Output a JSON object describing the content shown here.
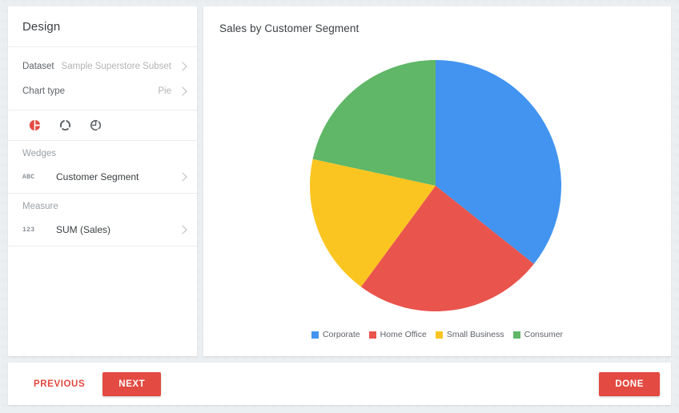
{
  "design_panel": {
    "title": "Design",
    "properties": [
      {
        "label": "Dataset",
        "value": "Sample Superstore Subset",
        "name": "dataset"
      },
      {
        "label": "Chart type",
        "value": "Pie",
        "name": "chart-type"
      }
    ],
    "chart_type_icons": [
      {
        "name": "pie-chart-icon",
        "selected": true,
        "color": "#e34a42"
      },
      {
        "name": "donut-chart-icon",
        "selected": false,
        "color": "#5f6368"
      },
      {
        "name": "half-donut-chart-icon",
        "selected": false,
        "color": "#5f6368"
      }
    ],
    "wedges": {
      "caption": "Wedges",
      "type_icon": "ABC",
      "field": "Customer Segment"
    },
    "measure": {
      "caption": "Measure",
      "type_icon": "123",
      "field": "SUM (Sales)"
    }
  },
  "footer": {
    "previous_label": "PREVIOUS",
    "next_label": "NEXT",
    "done_label": "DONE",
    "accent_color": "#e34a42"
  },
  "chart_data": {
    "type": "pie",
    "title": "Sales by Customer Segment",
    "categories": [
      "Corporate",
      "Home Office",
      "Small Business",
      "Consumer"
    ],
    "values": [
      35.7,
      24.4,
      18.3,
      21.6
    ],
    "colors": [
      "#4294f0",
      "#e9544d",
      "#fbc521",
      "#5fb767"
    ],
    "legend_position": "bottom",
    "xlabel": "",
    "ylabel": "",
    "start_angle_deg": 0,
    "direction": "clockwise"
  }
}
